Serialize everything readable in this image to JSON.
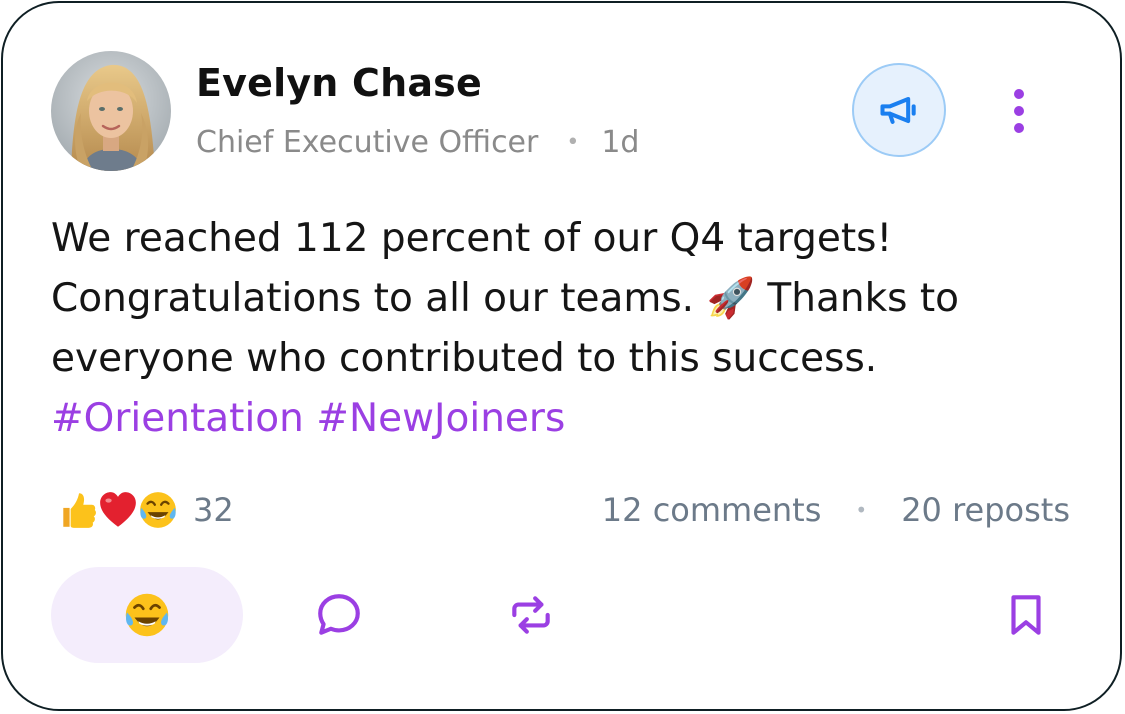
{
  "post": {
    "author": {
      "name": "Evelyn Chase",
      "title": "Chief Executive Officer",
      "time_ago": "1d",
      "separator": "•"
    },
    "body_text": "We reached 112 percent of our Q4 targets! Congratulations to all our teams. 🚀 Thanks to everyone who contributed to this success.",
    "hashtags": [
      "#Orientation",
      "#NewJoiners"
    ],
    "reactions": {
      "emojis": [
        "thumbs-up-icon",
        "red-heart-icon",
        "tears-of-joy-icon"
      ],
      "count": "32"
    },
    "stats": {
      "comments": "12 comments",
      "separator": "•",
      "reposts": "20 reposts"
    },
    "actions": {
      "react_icon": "tears-of-joy-icon",
      "comment_icon": "comment-bubble-icon",
      "repost_icon": "repost-icon",
      "save_icon": "bookmark-icon"
    },
    "header_buttons": {
      "announce_icon": "megaphone-icon",
      "more_icon": "more-vertical-icon"
    }
  },
  "colors": {
    "accent": "#9b3fe3",
    "announce_blue": "#1a7ff0",
    "announce_bg": "#e6f1fd",
    "react_bg": "#f4edfc",
    "muted_text": "#6c7a89",
    "border": "#0f1f24"
  }
}
